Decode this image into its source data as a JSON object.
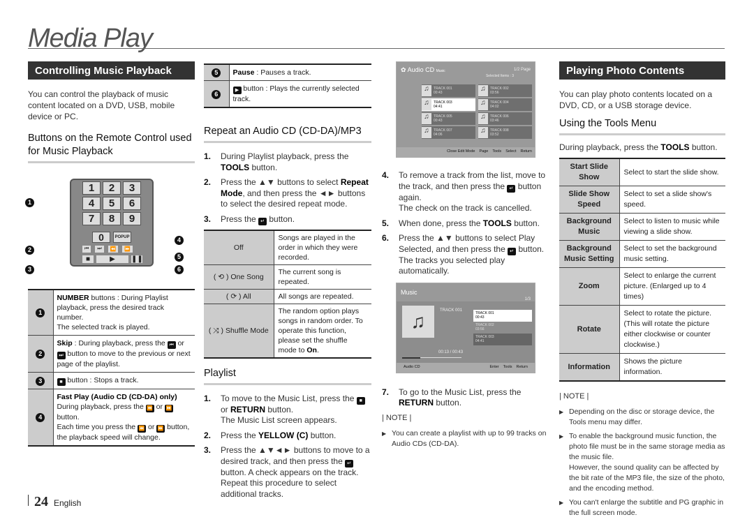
{
  "page_title": "Media Play",
  "col1": {
    "section_title": "Controlling Music Playback",
    "intro": "You can control the playback of music content located on a DVD, USB, mobile device or PC.",
    "subheading": "Buttons on the Remote Control used for Music Playback",
    "remote": {
      "keys": [
        "1",
        "2",
        "3",
        "4",
        "5",
        "6",
        "7",
        "8",
        "9",
        "0"
      ],
      "popup": "POPUP",
      "callouts": [
        "1",
        "2",
        "3",
        "4",
        "5",
        "6"
      ]
    },
    "table": [
      {
        "key": "1",
        "bold": "NUMBER",
        "text": " buttons : During Playlist playback, press the desired track number.",
        "extra": "The selected track is played."
      },
      {
        "key": "2",
        "bold": "Skip",
        "text": " : During playback, press the [prev] or [next] button to move to the previous or next page of the playlist."
      },
      {
        "key": "3",
        "text": "[stop] button : Stops a track."
      },
      {
        "key": "4",
        "bold": "Fast Play (Audio CD (CD-DA) only)",
        "text": "During playback, press the [rew] or [ff] button.",
        "extra": "Each time you press the [rew] or [ff] button, the playback speed will change."
      }
    ]
  },
  "col2": {
    "table": [
      {
        "key": "5",
        "bold": "Pause",
        "text": " : Pauses a track."
      },
      {
        "key": "6",
        "text": " button : Plays the currently selected track."
      }
    ],
    "repeat_heading": "Repeat an Audio CD (CD-DA)/MP3",
    "repeat_steps": [
      {
        "n": "1.",
        "a": "During Playlist playback, press the ",
        "b": "TOOLS",
        "c": " button."
      },
      {
        "n": "2.",
        "a": "Press the ▲▼ buttons to select ",
        "b": "Repeat Mode",
        "c": ", and then press the ◄► buttons to select the desired repeat mode."
      },
      {
        "n": "3.",
        "a": "Press the ",
        "c": " button."
      }
    ],
    "repeat_table": [
      {
        "mode": "Off",
        "desc": "Songs are played in the order in which they were recorded."
      },
      {
        "mode": "( ⟲ ) One Song",
        "desc": "The current song is repeated."
      },
      {
        "mode": "( ⟳ ) All",
        "desc": "All songs are repeated."
      },
      {
        "mode": "( ⤨ ) Shuffle Mode",
        "desc": "The random option plays songs in random order. To operate this function, please set the shuffle mode to ",
        "desc_bold": "On",
        "desc_end": "."
      }
    ],
    "playlist_heading": "Playlist",
    "playlist_steps": [
      {
        "n": "1.",
        "a": "To move to the Music List, press the ",
        "mid": " or ",
        "b": "RETURN",
        "c": " button.",
        "extra": "The Music List screen appears."
      },
      {
        "n": "2.",
        "a": "Press the ",
        "b": "YELLOW (C)",
        "c": " button."
      },
      {
        "n": "3.",
        "a": "Press the ▲▼◄► buttons to move to a desired track, and then press the ",
        "c": " button. A check appears on the track. Repeat this procedure to select additional tracks."
      }
    ]
  },
  "col3": {
    "screen1": {
      "title": "Audio CD",
      "crumb": "Music",
      "page": "1/2 Page",
      "selected": "Selected Items : 3",
      "tracks": [
        {
          "name": "TRACK 001",
          "time": "00:43"
        },
        {
          "name": "TRACK 002",
          "time": "03:56"
        },
        {
          "name": "TRACK 003",
          "time": "04:41"
        },
        {
          "name": "TRACK 004",
          "time": "04:02"
        },
        {
          "name": "TRACK 005",
          "time": "00:43"
        },
        {
          "name": "TRACK 006",
          "time": "03:46"
        },
        {
          "name": "TRACK 007",
          "time": "04:06"
        },
        {
          "name": "TRACK 008",
          "time": "03:52"
        }
      ],
      "footer": [
        "Close Edit Mode",
        "Page",
        "Tools",
        "Select",
        "Return"
      ]
    },
    "steps": [
      {
        "n": "4.",
        "a": "To remove a track from the list, move to the track, and then press the ",
        "c": " button again.",
        "extra": "The check on the track is cancelled."
      },
      {
        "n": "5.",
        "a": "When done, press the ",
        "b": "TOOLS",
        "c": " button."
      },
      {
        "n": "6.",
        "a": "Press the ▲▼ buttons to select Play Selected, and then press the ",
        "c": " button.",
        "extra": "The tracks you selected play automatically."
      }
    ],
    "screen2": {
      "title": "Music",
      "page": "1/3",
      "now": "TRACK 001",
      "time": "00:13 / 00:43",
      "progress": 0.3,
      "tracks": [
        {
          "name": "TRACK 001",
          "time": "00:43"
        },
        {
          "name": "TRACK 002",
          "time": "03:56"
        },
        {
          "name": "TRACK 003",
          "time": "04:41"
        }
      ],
      "source": "Audio CD",
      "footer": [
        "Enter",
        "Tools",
        "Return"
      ]
    },
    "step7": {
      "n": "7.",
      "a": "To go to the Music List, press the ",
      "b": "RETURN",
      "c": " button."
    },
    "note_label": "| NOTE |",
    "notes": [
      "You can create a playlist with up to 99 tracks on Audio CDs (CD-DA)."
    ]
  },
  "col4": {
    "section_title": "Playing Photo Contents",
    "intro": "You can play photo contents located on a DVD, CD, or a USB storage device.",
    "subheading": "Using the Tools Menu",
    "lead_a": "During playback, press the ",
    "lead_b": "TOOLS",
    "lead_c": " button.",
    "table": [
      {
        "k": "Start Slide Show",
        "v": "Select to start the slide show."
      },
      {
        "k": "Slide Show Speed",
        "v": "Select to set a slide show's speed."
      },
      {
        "k": "Background Music",
        "v": "Select to listen to music while viewing a slide show."
      },
      {
        "k": "Background Music Setting",
        "v": "Select to set the background music setting."
      },
      {
        "k": "Zoom",
        "v": "Select to enlarge the current picture. (Enlarged up to 4 times)"
      },
      {
        "k": "Rotate",
        "v": "Select to rotate the picture. (This will rotate the picture either clockwise or counter clockwise.)"
      },
      {
        "k": "Information",
        "v": "Shows the picture information."
      }
    ],
    "note_label": "| NOTE |",
    "notes": [
      "Depending on the disc or storage device, the Tools menu may differ.",
      "To enable the background music function, the photo file must be in the same storage media as the music file.",
      "You can't enlarge the subtitle and PG graphic in the full screen mode."
    ],
    "note2_extra": "However, the sound quality can be affected by the bit rate of the MP3 file, the size of the photo, and the encoding method."
  },
  "footer": {
    "page_number": "24",
    "language": "English"
  }
}
